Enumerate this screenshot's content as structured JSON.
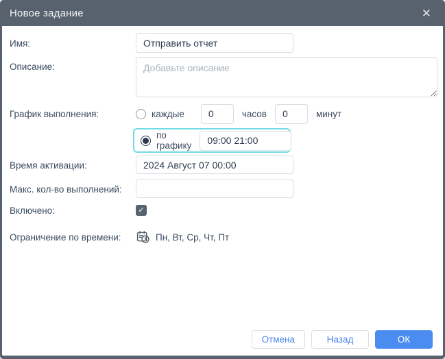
{
  "dialog": {
    "title": "Новое задание",
    "close_glyph": "✕"
  },
  "form": {
    "name": {
      "label": "Имя:",
      "value": "Отправить отчет"
    },
    "description": {
      "label": "Описание:",
      "placeholder": "Добавьте описание"
    },
    "schedule": {
      "label": "График выполнения:",
      "every": {
        "radio_label": "каждые",
        "hours_value": "0",
        "hours_unit": "часов",
        "minutes_value": "0",
        "minutes_unit": "минут",
        "selected": false
      },
      "by_schedule": {
        "radio_label": "по графику",
        "value": "09:00 21:00",
        "selected": true
      }
    },
    "activation_time": {
      "label": "Время активации:",
      "value": "2024 Август 07 00:00"
    },
    "max_executions": {
      "label": "Макс. кол-во выполнений:",
      "value": ""
    },
    "enabled": {
      "label": "Включено:",
      "checked": true,
      "check_glyph": "✓"
    },
    "time_restriction": {
      "label": "Ограничение по времени:",
      "value": "Пн, Вт, Ср, Чт, Пт"
    }
  },
  "footer": {
    "cancel_label": "Отмена",
    "back_label": "Назад",
    "ok_label": "ОК"
  },
  "colors": {
    "header_bg": "#57626e",
    "accent_blue": "#4a86e8",
    "accent_blue_btn": "#4a8cf0",
    "highlight_teal": "#74dbe2"
  }
}
